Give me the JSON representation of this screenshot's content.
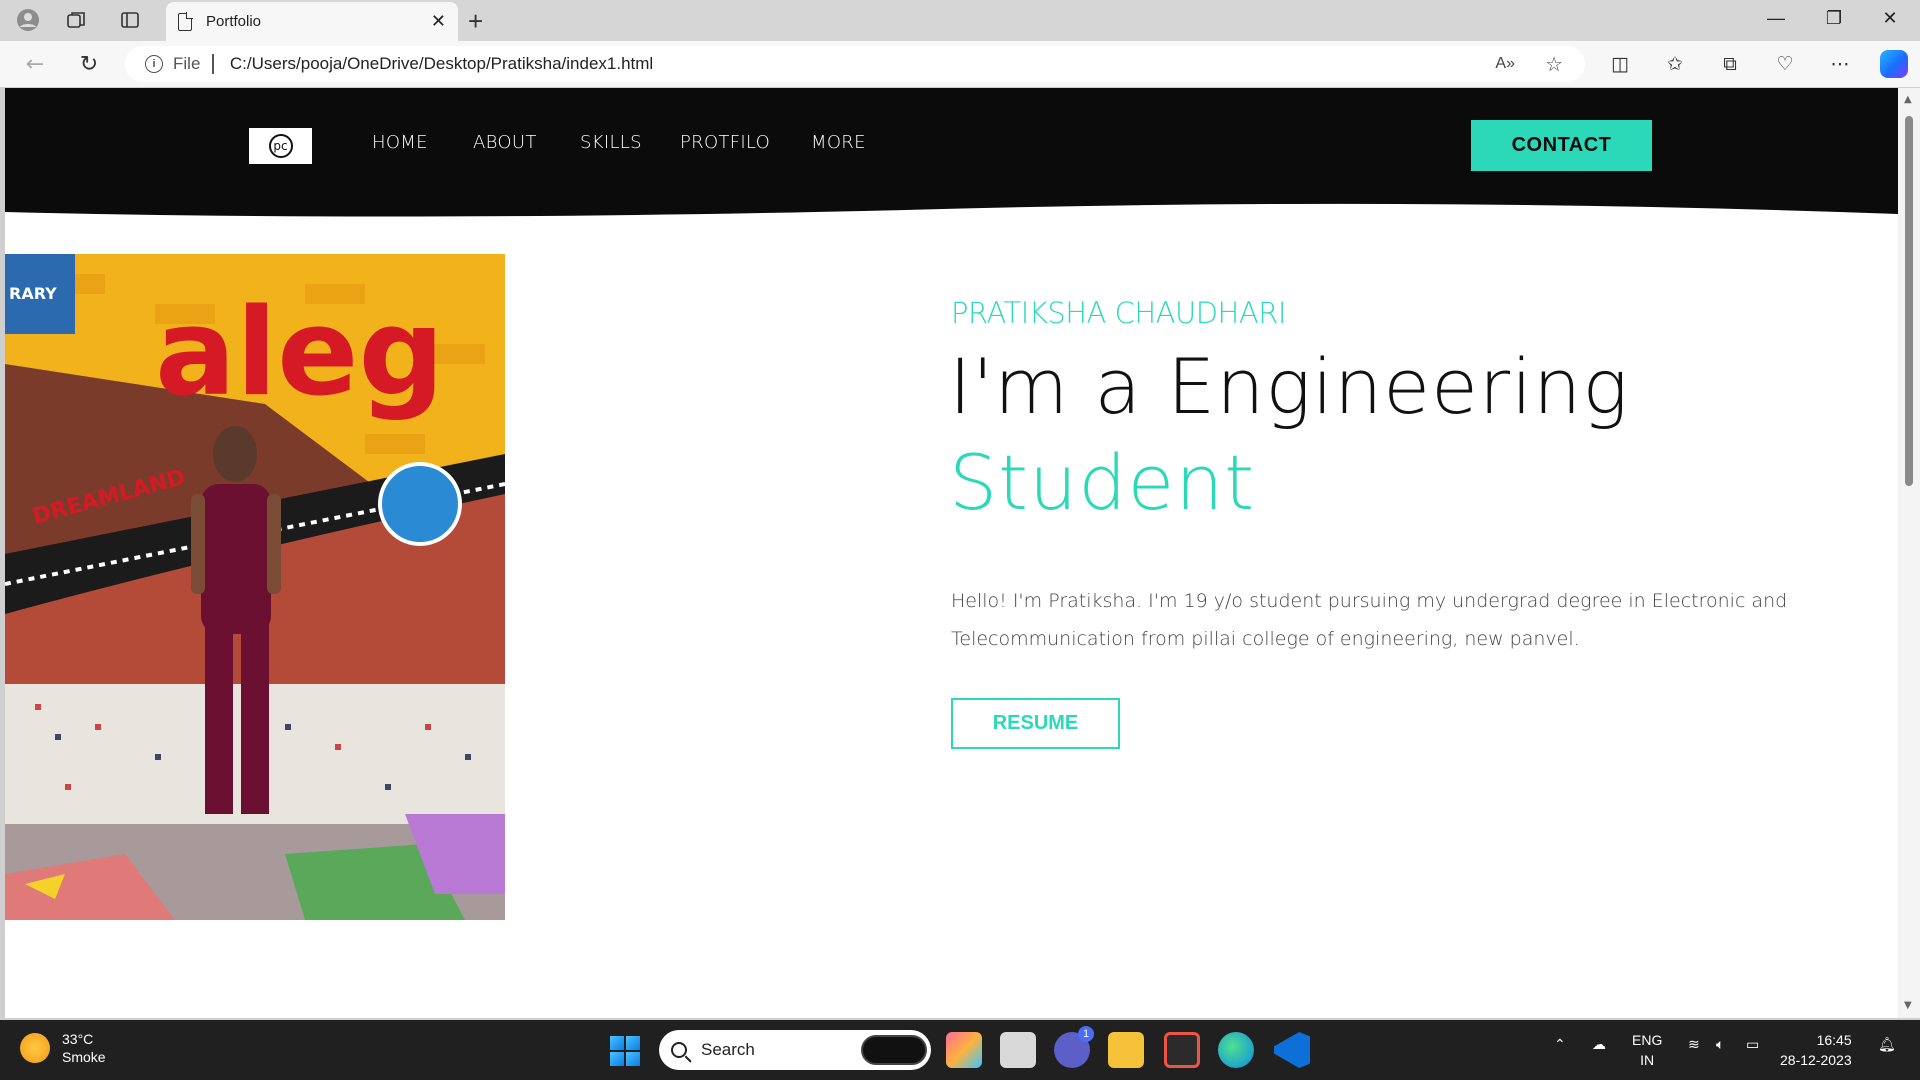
{
  "browser": {
    "tab_title": "Portfolio",
    "url_label": "File",
    "url": "C:/Users/pooja/OneDrive/Desktop/Pratiksha/index1.html"
  },
  "site": {
    "nav": [
      "HOME",
      "ABOUT",
      "SKILLS",
      "PROTFILO",
      "MORE"
    ],
    "contact_label": "CONTACT",
    "name": "PRATIKSHA CHAUDHARI",
    "headline_1": "I'm a Engineering",
    "headline_2": "Student",
    "bio": "Hello! I'm Pratiksha. I'm 19 y/o student pursuing my undergrad degree in Electronic and Telecommunication from pillai college of engineering, new panvel.",
    "resume_label": "RESUME",
    "accent_color": "#2bd9b9"
  },
  "taskbar": {
    "temperature": "33°C",
    "weather": "Smoke",
    "search_placeholder": "Search",
    "lang_1": "ENG",
    "lang_2": "IN",
    "time": "16:45",
    "date": "28-12-2023",
    "chat_badge": "1"
  }
}
